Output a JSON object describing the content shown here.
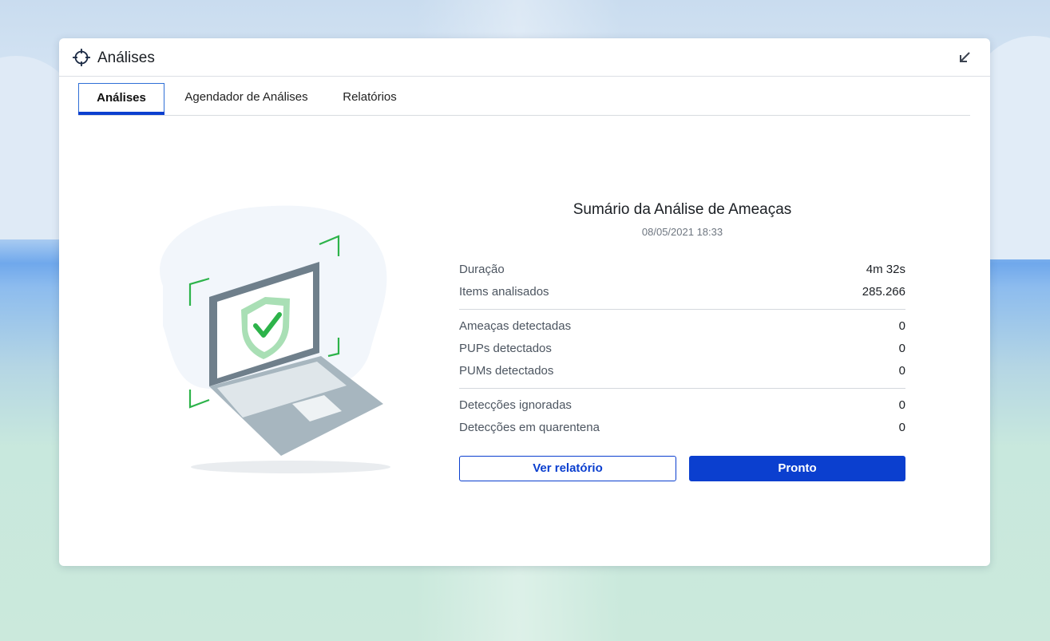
{
  "window": {
    "title": "Análises",
    "title_icon": "crosshair-icon",
    "collapse_icon": "arrow-down-left-icon"
  },
  "tabs": [
    {
      "label": "Análises",
      "active": true
    },
    {
      "label": "Agendador de Análises",
      "active": false
    },
    {
      "label": "Relatórios",
      "active": false
    }
  ],
  "illustration": {
    "icon": "laptop-shield-check-icon",
    "accent": "#2db34a"
  },
  "summary": {
    "title": "Sumário da Análise de Ameaças",
    "date": "08/05/2021 18:33",
    "groups": [
      [
        {
          "label": "Duração",
          "value": "4m 32s"
        },
        {
          "label": "Items analisados",
          "value": "285.266"
        }
      ],
      [
        {
          "label": "Ameaças detectadas",
          "value": "0"
        },
        {
          "label": "PUPs detectados",
          "value": "0"
        },
        {
          "label": "PUMs detectados",
          "value": "0"
        }
      ],
      [
        {
          "label": "Detecções ignoradas",
          "value": "0"
        },
        {
          "label": "Detecções em quarentena",
          "value": "0"
        }
      ]
    ]
  },
  "actions": {
    "view_report_label": "Ver relatório",
    "done_label": "Pronto"
  },
  "colors": {
    "primary": "#0b3fcf",
    "accent_green": "#2db34a"
  }
}
